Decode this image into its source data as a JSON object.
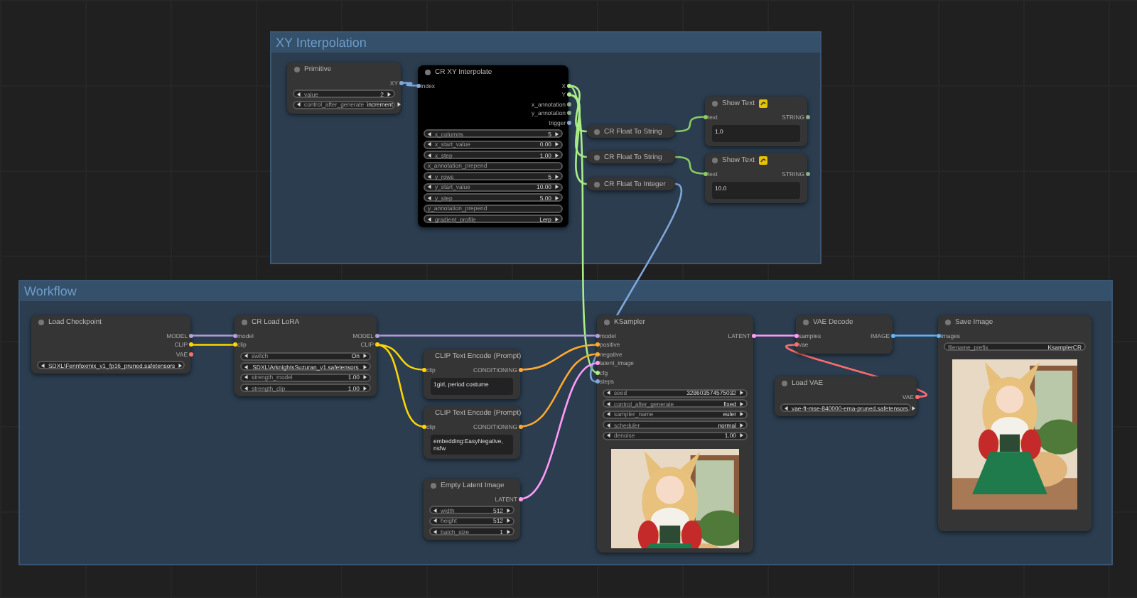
{
  "groups": [
    {
      "title": "XY Interpolation"
    },
    {
      "title": "Workflow"
    }
  ],
  "nodes": [
    {
      "title": "Primitive",
      "collapsed": false,
      "outputs": [
        {
          "label": "XY",
          "color": "#7fa7d9"
        }
      ],
      "widgets": [
        {
          "kind": "number",
          "name": "value",
          "value": "2"
        },
        {
          "kind": "combo",
          "name": "control_after_generate",
          "value": "increment"
        }
      ]
    },
    {
      "title": "CR XY Interpolate",
      "collapsed": false,
      "color": "#000000",
      "inputs": [
        {
          "label": "index",
          "color": "#7fa7d9"
        }
      ],
      "outputs": [
        {
          "label": "X",
          "color": "#aaee88"
        },
        {
          "label": "Y",
          "color": "#aaee88"
        },
        {
          "label": "x_annotation",
          "color": "#88aa88"
        },
        {
          "label": "y_annotation",
          "color": "#88aa88"
        },
        {
          "label": "trigger",
          "color": "#7fa7d9"
        }
      ],
      "widgets": [
        {
          "kind": "number",
          "name": "x_columns",
          "value": "5"
        },
        {
          "kind": "number",
          "name": "x_start_value",
          "value": "0.00"
        },
        {
          "kind": "number",
          "name": "x_step",
          "value": "1.00"
        },
        {
          "kind": "text",
          "name": "x_annotation_prepend"
        },
        {
          "kind": "number",
          "name": "y_rows",
          "value": "5"
        },
        {
          "kind": "number",
          "name": "y_start_value",
          "value": "10.00"
        },
        {
          "kind": "number",
          "name": "y_step",
          "value": "5.00"
        },
        {
          "kind": "text",
          "name": "y_annotation_prepend"
        },
        {
          "kind": "combo",
          "name": "gradient_profile",
          "value": "Lerp"
        }
      ]
    },
    {
      "title": "CR Float To String",
      "collapsed": true
    },
    {
      "title": "CR Float To String",
      "collapsed": true
    },
    {
      "title": "CR Float To Integer",
      "collapsed": true
    },
    {
      "title": "Show Text",
      "collapsed": false,
      "badge": true,
      "inputs": [
        {
          "label": "text",
          "color": "#88cc66"
        }
      ],
      "outputs": [
        {
          "label": "STRING",
          "color": "#88aa88"
        }
      ],
      "widgets": [
        {
          "kind": "textarea",
          "value": "1.0"
        }
      ]
    },
    {
      "title": "Show Text",
      "collapsed": false,
      "badge": true,
      "inputs": [
        {
          "label": "text",
          "color": "#88cc66"
        }
      ],
      "outputs": [
        {
          "label": "STRING",
          "color": "#88aa88"
        }
      ],
      "widgets": [
        {
          "kind": "textarea",
          "value": "10.0"
        }
      ]
    },
    {
      "title": "Load Checkpoint",
      "collapsed": false,
      "outputs": [
        {
          "label": "MODEL",
          "color": "#b39ddb"
        },
        {
          "label": "CLIP",
          "color": "#ffd500"
        },
        {
          "label": "VAE",
          "color": "#ff6e6e"
        }
      ],
      "widgets": [
        {
          "kind": "combo",
          "value": "SDXL\\Fennfoxmix_v1_fp16_pruned.safetensors"
        }
      ]
    },
    {
      "title": "CR Load LoRA",
      "collapsed": false,
      "inputs": [
        {
          "label": "model",
          "color": "#b39ddb"
        },
        {
          "label": "clip",
          "color": "#ffd500"
        }
      ],
      "outputs": [
        {
          "label": "MODEL",
          "color": "#b39ddb"
        },
        {
          "label": "CLIP",
          "color": "#ffd500"
        }
      ],
      "widgets": [
        {
          "kind": "combo",
          "name": "switch",
          "value": "On"
        },
        {
          "kind": "combo",
          "value": "SDXL\\ArknightsSuzuran_v1.safetensors"
        },
        {
          "kind": "number",
          "name": "strength_model",
          "value": "1.00"
        },
        {
          "kind": "number",
          "name": "strength_clip",
          "value": "1.00"
        }
      ]
    },
    {
      "title": "CLIP Text Encode (Prompt)",
      "collapsed": false,
      "inputs": [
        {
          "label": "clip",
          "color": "#ffd500"
        }
      ],
      "outputs": [
        {
          "label": "CONDITIONING",
          "color": "#ffa931"
        }
      ],
      "widgets": [
        {
          "kind": "textarea",
          "value": "1girl, period costume"
        }
      ]
    },
    {
      "title": "CLIP Text Encode (Prompt)",
      "collapsed": false,
      "inputs": [
        {
          "label": "clip",
          "color": "#ffd500"
        }
      ],
      "outputs": [
        {
          "label": "CONDITIONING",
          "color": "#ffa931"
        }
      ],
      "widgets": [
        {
          "kind": "textarea",
          "value": "embedding:EasyNegative, nsfw"
        }
      ]
    },
    {
      "title": "Empty Latent Image",
      "collapsed": false,
      "outputs": [
        {
          "label": "LATENT",
          "color": "#ff9cf9"
        }
      ],
      "widgets": [
        {
          "kind": "number",
          "name": "width",
          "value": "512"
        },
        {
          "kind": "number",
          "name": "height",
          "value": "512"
        },
        {
          "kind": "number",
          "name": "batch_size",
          "value": "1"
        }
      ]
    },
    {
      "title": "KSampler",
      "collapsed": false,
      "inputs": [
        {
          "label": "model",
          "color": "#b39ddb"
        },
        {
          "label": "positive",
          "color": "#ffa931"
        },
        {
          "label": "negative",
          "color": "#ffa931"
        },
        {
          "label": "latent_image",
          "color": "#ff9cf9"
        },
        {
          "label": "cfg",
          "color": "#aaee88"
        },
        {
          "label": "steps",
          "color": "#7fa7d9"
        }
      ],
      "outputs": [
        {
          "label": "LATENT",
          "color": "#ff9cf9"
        }
      ],
      "widgets": [
        {
          "kind": "number",
          "name": "seed",
          "value": "328603574575032"
        },
        {
          "kind": "combo",
          "name": "control_after_generate",
          "value": "fixed"
        },
        {
          "kind": "combo",
          "name": "sampler_name",
          "value": "euler"
        },
        {
          "kind": "combo",
          "name": "scheduler",
          "value": "normal"
        },
        {
          "kind": "number",
          "name": "denoise",
          "value": "1.00"
        }
      ],
      "image": {
        "kind": "picture"
      }
    },
    {
      "title": "VAE Decode",
      "collapsed": false,
      "inputs": [
        {
          "label": "samples",
          "color": "#ff9cf9"
        },
        {
          "label": "vae",
          "color": "#ff6e6e"
        }
      ],
      "outputs": [
        {
          "label": "IMAGE",
          "color": "#64b5f6"
        }
      ]
    },
    {
      "title": "Load VAE",
      "collapsed": false,
      "outputs": [
        {
          "label": "VAE",
          "color": "#ff6e6e"
        }
      ],
      "widgets": [
        {
          "kind": "combo",
          "value": "vae-ft-mse-840000-ema-pruned.safetensors"
        }
      ]
    },
    {
      "title": "Save Image",
      "collapsed": false,
      "inputs": [
        {
          "label": "images",
          "color": "#64b5f6"
        }
      ],
      "widgets": [
        {
          "kind": "text",
          "name": "filename_prefix",
          "value": "KsamplerCR"
        }
      ],
      "image": {
        "kind": "picture"
      }
    }
  ]
}
